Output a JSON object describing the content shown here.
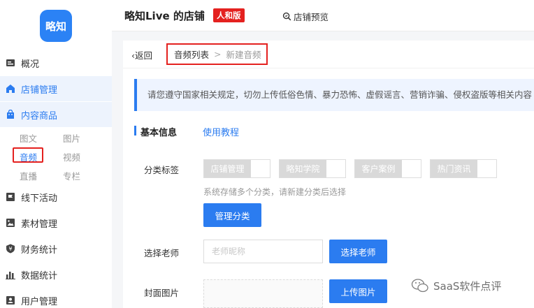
{
  "sidebar": {
    "logo_text": "略知",
    "items": [
      {
        "label": "概况",
        "icon": "overview-icon"
      },
      {
        "label": "店铺管理",
        "icon": "store-icon"
      },
      {
        "label": "内容商品",
        "icon": "bag-icon"
      },
      {
        "label": "线下活动",
        "icon": "flag-icon"
      },
      {
        "label": "素材管理",
        "icon": "image-icon"
      },
      {
        "label": "财务统计",
        "icon": "yen-icon"
      },
      {
        "label": "数据统计",
        "icon": "bar-chart-icon"
      },
      {
        "label": "用户管理",
        "icon": "user-icon"
      }
    ],
    "sub_items": [
      "图文",
      "图片",
      "音频",
      "视频",
      "直播",
      "专栏"
    ],
    "selected_sub": "音频",
    "accent": "#2b7cf0"
  },
  "header": {
    "shop_title": "略知Live 的店铺",
    "plan_badge": "人和版",
    "preview_label": "店铺预览"
  },
  "main": {
    "back_label": "返回",
    "breadcrumb": [
      "音频列表",
      ">",
      "新建音频"
    ],
    "notice": "请您遵守国家相关规定，切勿上传低俗色情、暴力恐怖、虚假谣言、营销诈骗、侵权盗版等相关内容",
    "section_title": "基本信息",
    "tutorial_link": "使用教程",
    "category": {
      "label": "分类标签",
      "tags": [
        "店铺管理",
        "略知学院",
        "客户案例",
        "热门资讯"
      ],
      "hint": "系统存储多个分类，请新建分类后选择",
      "manage_button": "管理分类"
    },
    "teacher": {
      "label": "选择老师",
      "placeholder": "老师昵称",
      "button": "选择老师"
    },
    "cover": {
      "label": "封面图片",
      "button": "上传图片"
    }
  },
  "watermark": "SaaS软件点评",
  "colors": {
    "primary": "#2b7cf0",
    "highlight_red": "#e4211f"
  }
}
